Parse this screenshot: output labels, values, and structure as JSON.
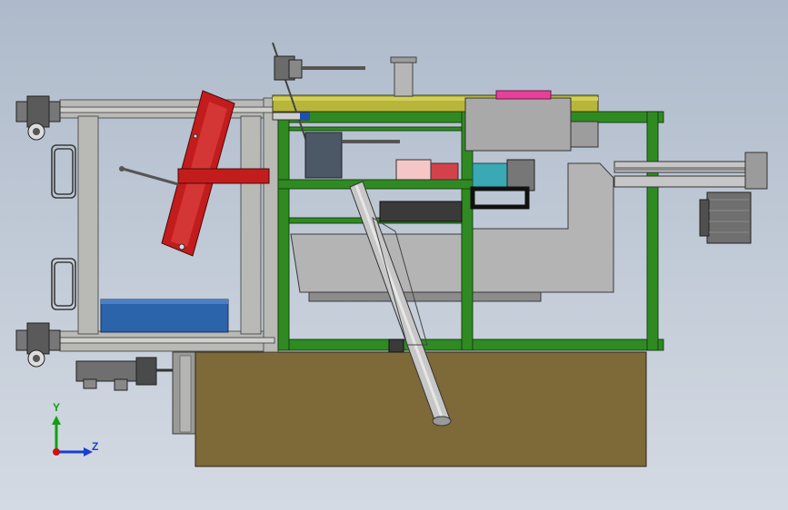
{
  "view": {
    "background_top": "#aebacb",
    "background_bottom": "#d4dae3"
  },
  "colors": {
    "frame_green": "#2f8a22",
    "frame_gray": "#b9b9b6",
    "base_brown": "#7d6a38",
    "top_plate": "#b8b63a",
    "tray_red": "#c21c1c",
    "bin_blue": "#2c64ab",
    "housing_gray": "#b4b4b4",
    "pink_accent": "#e8409a",
    "cyan_part": "#3aa9b4"
  },
  "axes": {
    "y_label": "Y",
    "z_label": "Z",
    "y_color": "#10a010",
    "z_color": "#1a3fd0",
    "origin_color": "#d01010"
  },
  "parts": [
    "base-block",
    "left-gray-frame",
    "green-main-frame",
    "top-yellow-plate",
    "red-tray",
    "blue-bin",
    "gray-housing",
    "diagonal-tube",
    "right-extension",
    "servo-motor",
    "upper-caster",
    "lower-caster",
    "bottom-motor-assembly",
    "spindle-assembly",
    "electrical-box"
  ]
}
